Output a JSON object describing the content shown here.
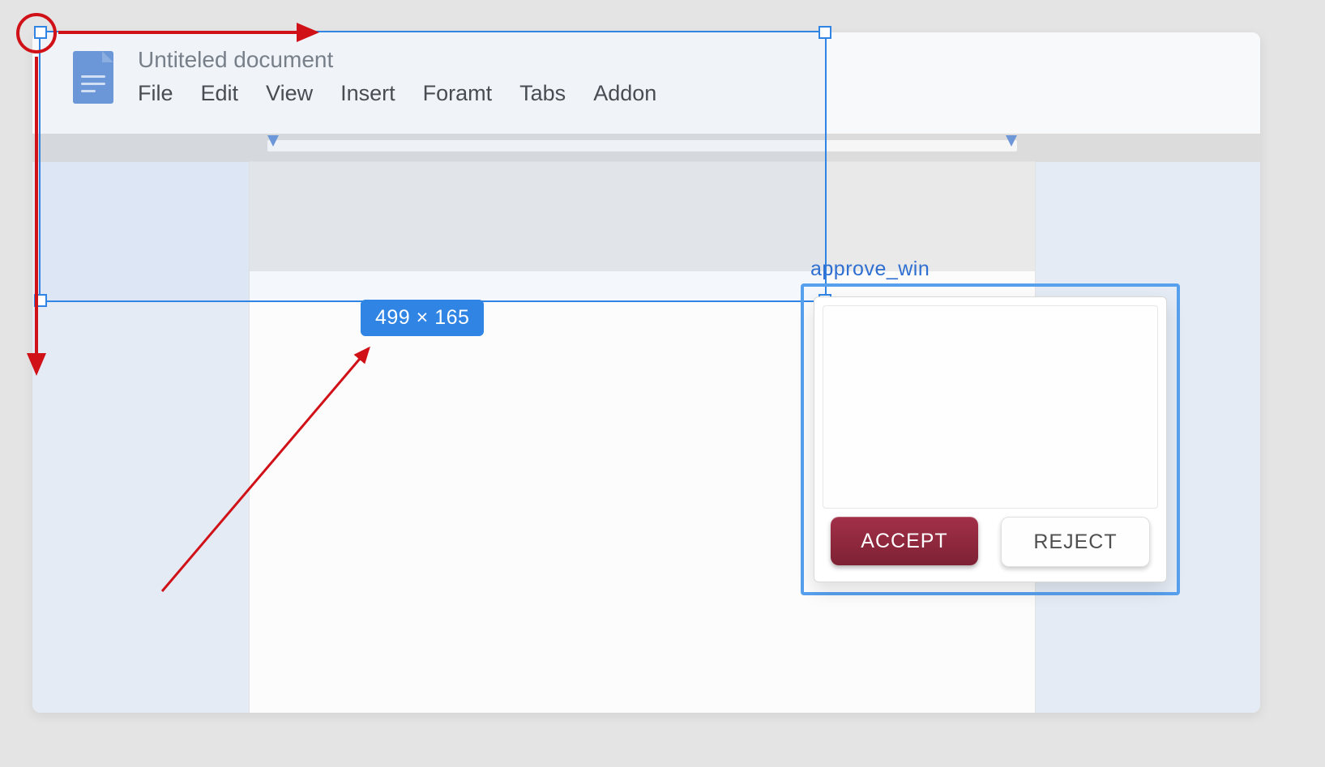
{
  "doc": {
    "title": "Untiteled document"
  },
  "menu": {
    "file": "File",
    "edit": "Edit",
    "view": "View",
    "insert": "Insert",
    "format": "Foramt",
    "tabs": "Tabs",
    "addon": "Addon"
  },
  "selection": {
    "size_label": "499 × 165"
  },
  "approve": {
    "window_label": "approve_win",
    "accept": "ACCEPT",
    "reject": "REJECT"
  }
}
